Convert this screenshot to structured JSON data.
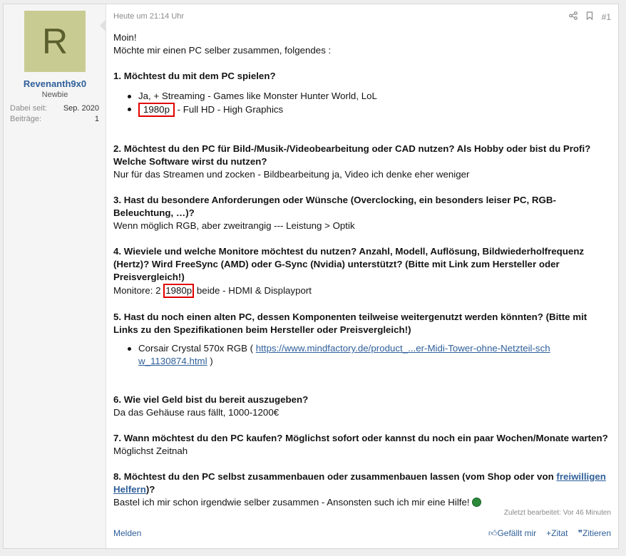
{
  "user": {
    "avatar_letter": "R",
    "name": "Revenanth9x0",
    "title": "Newbie",
    "stats": [
      {
        "label": "Dabei seit:",
        "value": "Sep. 2020"
      },
      {
        "label": "Beiträge:",
        "value": "1"
      }
    ]
  },
  "post": {
    "date": "Heute um 21:14 Uhr",
    "number": "#1",
    "greeting": "Moin!",
    "intro": "Möchte mir einen PC selber zusammen, folgendes :",
    "q1": "1. Möchtest du mit dem PC spielen?",
    "q1_items": [
      "Ja, + Streaming - Games like Monster Hunter World, LoL"
    ],
    "q1_item2_mark": "1980p",
    "q1_item2_rest": " - Full HD - High Graphics",
    "q2": "2. Möchtest du den PC für Bild-/Musik-/Videobearbeitung oder CAD nutzen? Als Hobby oder bist du Profi? Welche Software wirst du nutzen?",
    "a2": "Nur für das Streamen und zocken - Bildbearbeitung ja, Video ich denke eher weniger",
    "q3": "3. Hast du besondere Anforderungen oder Wünsche (Overclocking, ein besonders leiser PC, RGB-Beleuchtung, …)?",
    "a3": "Wenn möglich RGB, aber zweitrangig --- Leistung > Optik",
    "q4": "4. Wieviele und welche Monitore möchtest du nutzen? Anzahl, Modell, Auflösung, Bildwiederholfrequenz (Hertz)? Wird FreeSync (AMD) oder G-Sync (Nvidia) unterstützt? (Bitte mit Link zum Hersteller oder Preisvergleich!)",
    "a4_pre": "Monitore: 2 ",
    "a4_mark": "1980p",
    "a4_post": " beide - HDMI & Displayport",
    "q5": "5. Hast du noch einen alten PC, dessen Komponenten teilweise weitergenutzt werden könnten? (Bitte mit Links zu den Spezifikationen beim Hersteller oder Preisvergleich!)",
    "a5_pre": "Corsair Crystal 570x RGB ( ",
    "a5_link": "https://www.mindfactory.de/product_...er-Midi-Tower-ohne-Netzteil-schw_1130874.html",
    "a5_post": " )",
    "q6": "6. Wie viel Geld bist du bereit auszugeben?",
    "a6": "Da das Gehäuse raus fällt, 1000-1200€",
    "q7": "7. Wann möchtest du den PC kaufen? Möglichst sofort oder kannst du noch ein paar Wochen/Monate warten?",
    "a7": "Möglichst Zeitnah",
    "q8_pre": "8. Möchtest du den PC selbst zusammenbauen oder zusammenbauen lassen (vom Shop oder von ",
    "q8_link": "freiwilligen Helfern",
    "q8_post": ")?",
    "a8": "Bastel ich mir schon irgendwie selber zusammen - Ansonsten such ich mir eine Hilfe!",
    "edited": "Zuletzt bearbeitet: Vor 46 Minuten"
  },
  "footer": {
    "report": "Melden",
    "like": "Gefällt mir",
    "quote_add": "Zitat",
    "quote": "Zitieren"
  },
  "colors": {
    "link": "#2f5f9a",
    "highlight_box": "#e00000",
    "avatar_bg": "#c9cc92"
  }
}
